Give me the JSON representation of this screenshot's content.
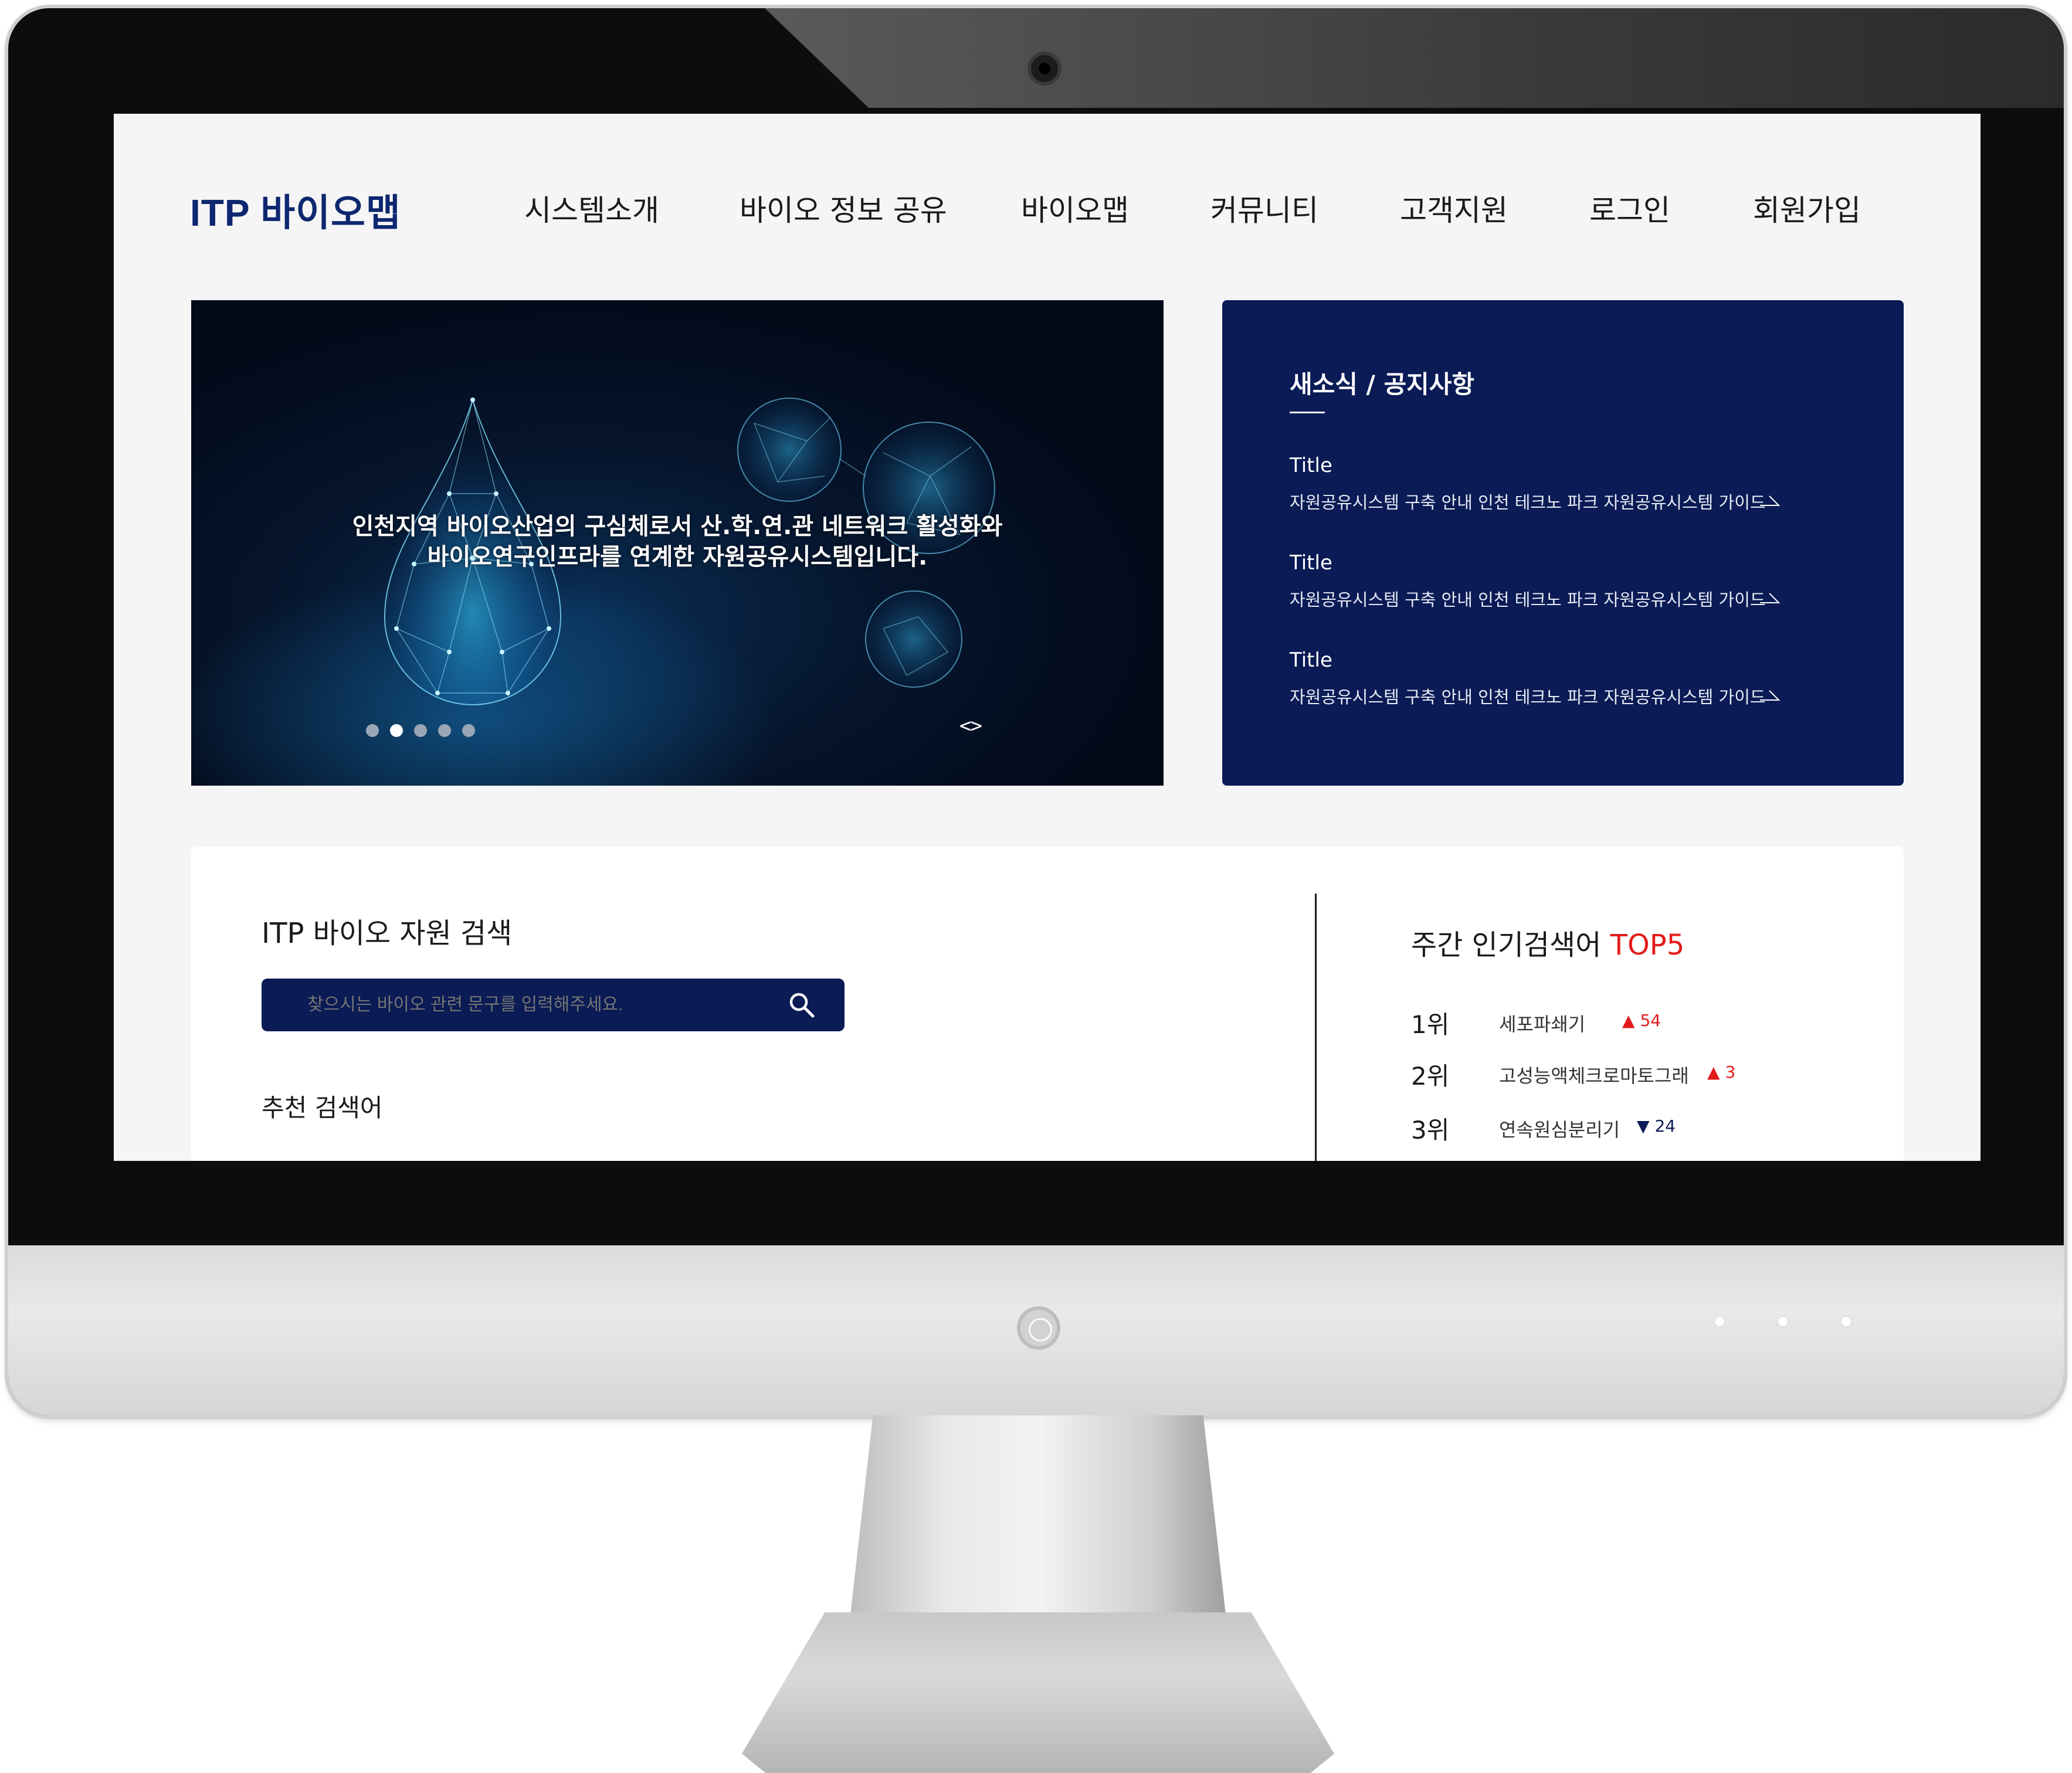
{
  "site": {
    "logo": "ITP 바이오맵"
  },
  "nav": {
    "items": [
      "시스템소개",
      "바이오 정보 공유",
      "바이오맵",
      "커뮤니티",
      "고객지원",
      "로그인",
      "회원가입"
    ]
  },
  "hero": {
    "line1": "인천지역 바이오산업의 구심체로서 산.학.연.관 네트워크 활성화와",
    "line2": "바이오연구인프라를 연계한 자원공유시스템입니다.",
    "slide_count": 5,
    "active_slide": 2,
    "arrows": "<>"
  },
  "news": {
    "title": "새소식 / 공지사항",
    "items": [
      {
        "title": "Title",
        "desc": "자원공유시스템 구축 안내 인천 테크노 파크 자원공유시스템 가이드"
      },
      {
        "title": "Title",
        "desc": "자원공유시스템 구축 안내 인천 테크노 파크 자원공유시스템 가이드"
      },
      {
        "title": "Title",
        "desc": "자원공유시스템 구축 안내 인천 테크노 파크 자원공유시스템 가이드"
      }
    ]
  },
  "search": {
    "title": "ITP 바이오 자원 검색",
    "placeholder": "찾으시는 바이오 관련 문구를 입력해주세요.",
    "recommended_title": "추천 검색어"
  },
  "top5": {
    "title_prefix": "주간 인기검색어 ",
    "title_accent": "TOP5",
    "items": [
      {
        "rank": "1위",
        "term": "세포파쇄기",
        "direction": "up",
        "symbol": "▲",
        "change": "54"
      },
      {
        "rank": "2위",
        "term": "고성능액체크로마토그래",
        "direction": "up",
        "symbol": "▲",
        "change": "3"
      },
      {
        "rank": "3위",
        "term": "연속원심분리기",
        "direction": "down",
        "symbol": "▼",
        "change": "24"
      }
    ]
  },
  "colors": {
    "brand_navy": "#0a1b55",
    "accent_red": "#e31b1b",
    "logo_blue": "#0d2770"
  }
}
